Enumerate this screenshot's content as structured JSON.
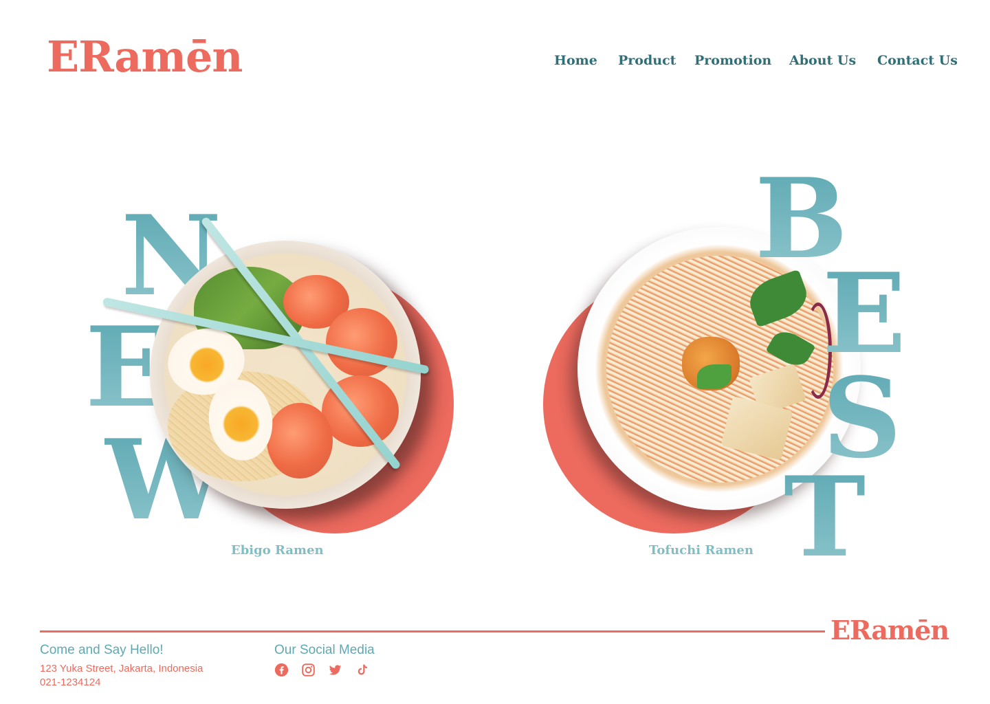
{
  "brand": {
    "logo_text": "ERamēn",
    "accent_color": "#ec6a5e",
    "teal_color": "#5ea9b3"
  },
  "nav": {
    "items": [
      {
        "label": "Home",
        "active": true
      },
      {
        "label": "Product"
      },
      {
        "label": "Promotion"
      },
      {
        "label": "About Us"
      },
      {
        "label": "Contact Us"
      }
    ]
  },
  "hero": {
    "left": {
      "word_letters": [
        "N",
        "E",
        "W"
      ],
      "caption": "Ebigo Ramen"
    },
    "right": {
      "word_letters": [
        "B",
        "E",
        "S",
        "T"
      ],
      "caption": "Tofuchi Ramen"
    }
  },
  "footer": {
    "logo_text": "ERamēn",
    "contact": {
      "heading": "Come and Say Hello!",
      "address": "123 Yuka Street, Jakarta, Indonesia",
      "phone": "021-1234124"
    },
    "social": {
      "heading": "Our Social Media",
      "icons": [
        "facebook-icon",
        "instagram-icon",
        "twitter-icon",
        "tiktok-icon"
      ]
    }
  }
}
